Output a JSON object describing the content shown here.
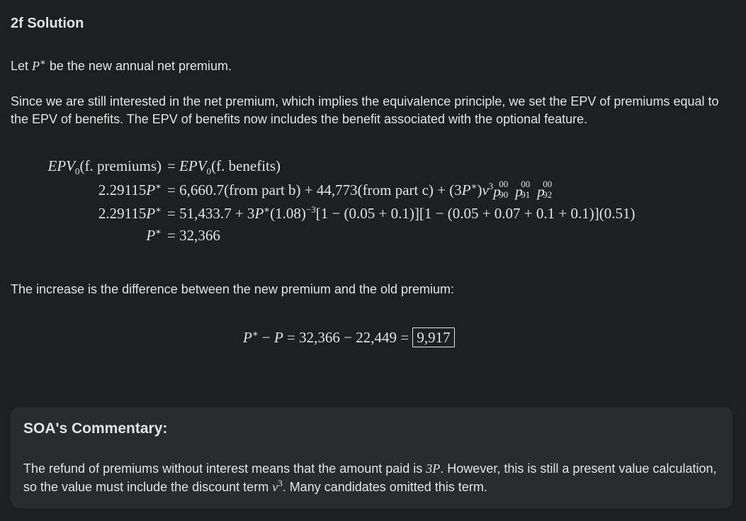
{
  "section": {
    "title": "2f Solution"
  },
  "intro": {
    "before": "Let ",
    "symbol": "P*",
    "after": " be the new annual net premium."
  },
  "explanation": "Since we are still interested in the net premium, which implies the equivalence principle, we set the EPV of premiums equal to the EPV of benefits. The EPV of benefits now includes the benefit associated with the optional feature.",
  "equations": [
    {
      "lhs": "EPV₀(f. premiums)",
      "rhs": "= EPV₀(f. benefits)"
    },
    {
      "lhs": "2.29115P*",
      "rhs": "= 6,660.7(from part b) + 44,773(from part c) + (3P*)v³ p90 p91 p92"
    },
    {
      "lhs": "2.29115P*",
      "rhs": "= 51,433.7 + 3P*(1.08)⁻³[1 − (0.05 + 0.1)][1 − (0.05 + 0.07 + 0.1 + 0.1)](0.51)"
    },
    {
      "lhs": "P*",
      "rhs": "= 32,366"
    }
  ],
  "increase": {
    "text": "The increase is the difference between the new premium and the old premium:",
    "equation": "P* − P = 32,366 − 22,449 =",
    "answer": "9,917"
  },
  "commentary": {
    "title": "SOA's Commentary:",
    "part1": "The refund of premiums without interest means that the amount paid is ",
    "symbol1": "3P",
    "part2": ". However, this is still a present value calculation, so the value must include the discount term ",
    "symbol2": "v³",
    "part3": ". Many candidates omitted this term."
  }
}
